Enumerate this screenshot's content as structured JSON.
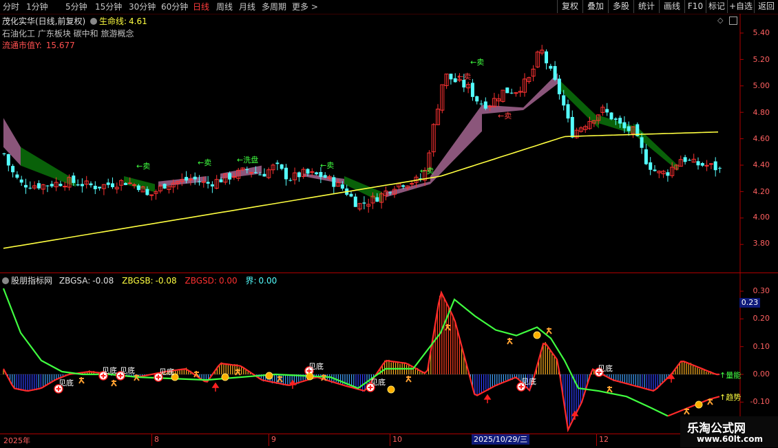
{
  "toolbar": {
    "periods": [
      "分时",
      "1分钟",
      "5分钟",
      "15分钟",
      "30分钟",
      "60分钟",
      "日线",
      "周线",
      "月线",
      "多周期",
      "更多 >"
    ],
    "active_period": "日线",
    "right_buttons": [
      "复权",
      "叠加",
      "多股",
      "统计",
      "画线",
      "F10",
      "标记",
      "+自选",
      "返回"
    ]
  },
  "main": {
    "title": "茂化实华(日线,前复权)",
    "life_line_label": "生命线:",
    "life_line_value": "4.61",
    "sector_tags": "石油化工 广东板块 碳中和 旅游概念",
    "float_cap_label": "流通市值Y:",
    "float_cap_value": "15.677",
    "y_ticks": [
      "5.40",
      "5.20",
      "5.00",
      "4.80",
      "4.60",
      "4.40",
      "4.20",
      "4.00",
      "3.80"
    ],
    "signals": [
      "←卖",
      "←卖",
      "←洗盘",
      "←卖",
      "←卖",
      "←卖",
      "←卖",
      "←卖"
    ]
  },
  "indicator": {
    "name": "股朋指标网",
    "zbgsa_label": "ZBGSA:",
    "zbgsa_value": "-0.08",
    "zbgsb_label": "ZBGSB:",
    "zbgsb_value": "-0.08",
    "zbgsd_label": "ZBGSD:",
    "zbgsd_value": "0.00",
    "jie_label": "界:",
    "jie_value": "0.00",
    "y_ticks": [
      "0.30",
      "0.20",
      "0.10",
      "0.00",
      "-0.10"
    ],
    "current_value": "0.23",
    "momentum_label": "量能",
    "trend_label": "趋势",
    "bottom_label": "见底"
  },
  "xaxis": {
    "labels": [
      "2025年",
      "8",
      "9",
      "10",
      "12"
    ],
    "cursor_date": "2025/10/29/三"
  },
  "watermark": {
    "brand": "乐淘公式网",
    "url": "www.60lt.com"
  },
  "colors": {
    "up": "#ff3232",
    "down": "#54ffff",
    "life_line": "#ffff40",
    "band_bear": "#0a6b0a",
    "band_bull": "#9a5f88",
    "axis": "#b00000"
  }
}
